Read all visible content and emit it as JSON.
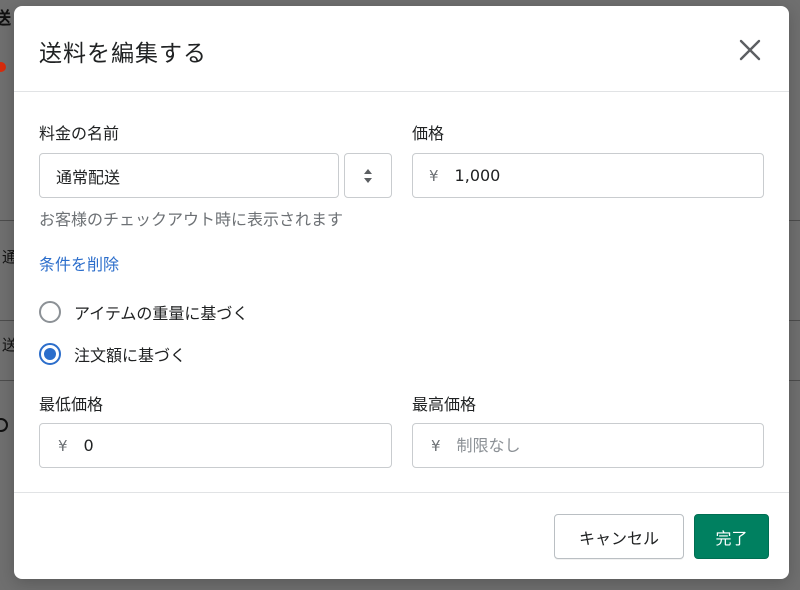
{
  "background": {
    "title_fragment": "送",
    "row1_fragment": "通",
    "row2_fragment": "送"
  },
  "modal": {
    "title": "送料を編集する",
    "close_icon": "close-icon"
  },
  "form": {
    "rate_name": {
      "label": "料金の名前",
      "value": "通常配送",
      "help_text": "お客様のチェックアウト時に表示されます"
    },
    "price": {
      "label": "価格",
      "prefix": "¥",
      "value": "1,000"
    },
    "remove_conditions_link": "条件を削除",
    "condition_options": [
      {
        "label": "アイテムの重量に基づく",
        "checked": false
      },
      {
        "label": "注文額に基づく",
        "checked": true
      }
    ],
    "min_price": {
      "label": "最低価格",
      "prefix": "¥",
      "value": "0"
    },
    "max_price": {
      "label": "最高価格",
      "prefix": "¥",
      "placeholder": "制限なし"
    }
  },
  "footer": {
    "cancel_label": "キャンセル",
    "done_label": "完了"
  },
  "colors": {
    "primary": "#008060",
    "link": "#2c6ecb",
    "radio_checked": "#2c6ecb",
    "overlay": "#6f6f6f"
  }
}
